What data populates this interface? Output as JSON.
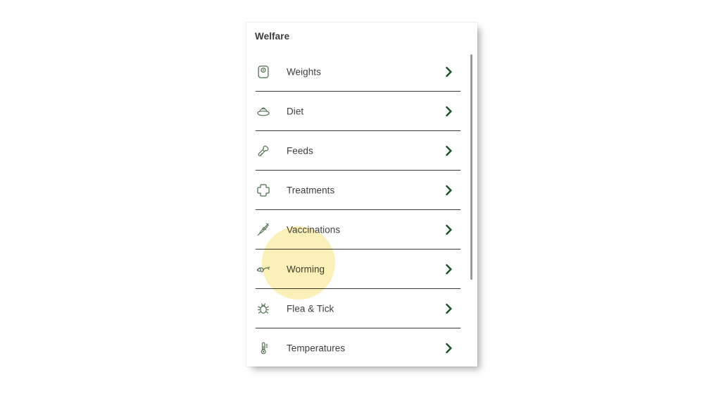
{
  "panel": {
    "title": "Welfare",
    "accent_green": "#1d5128",
    "text_color": "#3f3f3f",
    "icon_color": "#5d7a5d",
    "divider_color": "#3a3a3a",
    "highlight_color": "#fbf0b2",
    "scrollbar_color": "#9a9a9a"
  },
  "list": {
    "items": [
      {
        "label": "Weights",
        "icon": "weight-scale-icon"
      },
      {
        "label": "Diet",
        "icon": "food-bowl-icon"
      },
      {
        "label": "Feeds",
        "icon": "feed-scoop-icon"
      },
      {
        "label": "Treatments",
        "icon": "medical-cross-icon"
      },
      {
        "label": "Vaccinations",
        "icon": "syringe-icon"
      },
      {
        "label": "Worming",
        "icon": "worm-icon"
      },
      {
        "label": "Flea & Tick",
        "icon": "tick-bug-icon"
      },
      {
        "label": "Temperatures",
        "icon": "thermometer-icon"
      }
    ],
    "chevron_icon": "chevron-right-icon"
  },
  "highlight": {
    "target_label": "Worming",
    "shape": "circle"
  }
}
